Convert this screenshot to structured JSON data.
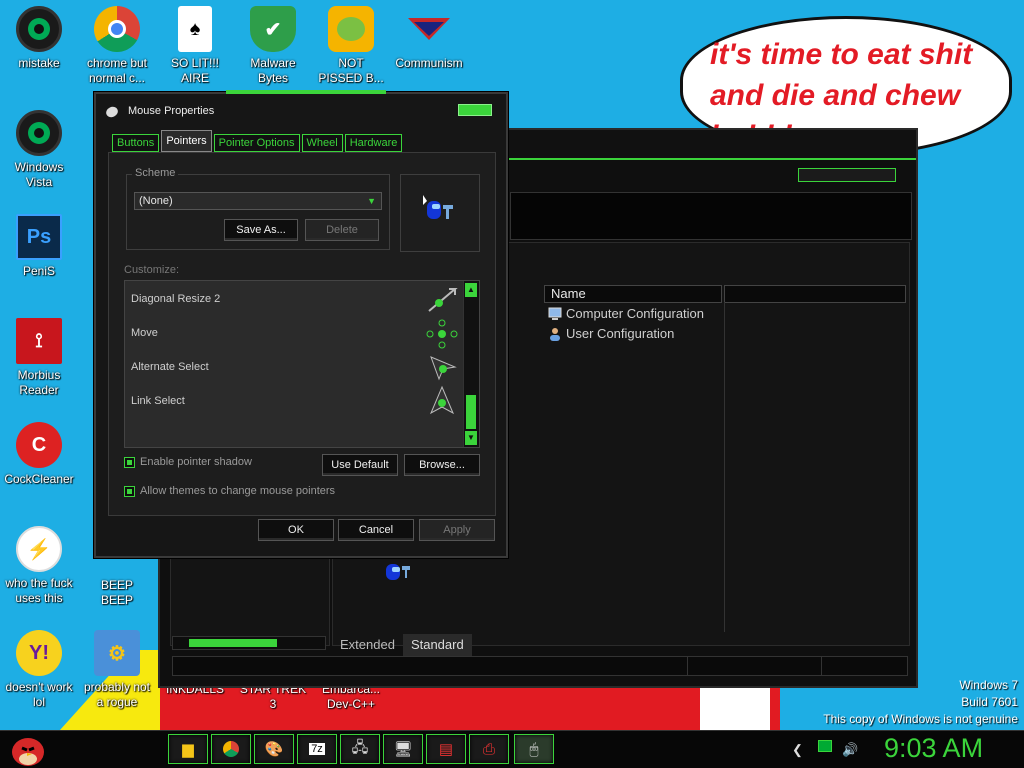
{
  "desktop": {
    "icons": [
      {
        "label": "mistake"
      },
      {
        "label": "chrome but\nnormal c..."
      },
      {
        "label": "SO LIT!!!\nAIRE"
      },
      {
        "label": "Malware\nBytes"
      },
      {
        "label": "NOT\nPISSED B..."
      },
      {
        "label": "Communism"
      },
      {
        "label": "Windows\nVista"
      },
      {
        "label": "PeniS"
      },
      {
        "label": "Morbius\nReader"
      },
      {
        "label": "CockCleaner"
      },
      {
        "label": "who the fuck\nuses this"
      },
      {
        "label": "BEEP\nBEEP"
      },
      {
        "label": "doesn't work\nlol"
      },
      {
        "label": "probably not\na rogue"
      },
      {
        "label": "INKDALLS"
      },
      {
        "label": "STAR TREK\n3"
      },
      {
        "label": "Embarca...\nDev-C++"
      }
    ],
    "bubble_text": "it's time to eat shit and die and chew bubble gum",
    "watermark": {
      "line1": "Windows 7",
      "line2": "Build 7601",
      "line3": "This copy of Windows is not genuine"
    }
  },
  "explorer": {
    "column_name": "Name",
    "items": [
      "Computer Configuration",
      "User Configuration"
    ],
    "view_tabs": [
      "Extended",
      "Standard"
    ]
  },
  "dialog": {
    "title": "Mouse Properties",
    "tabs": [
      "Buttons",
      "Pointers",
      "Pointer Options",
      "Wheel",
      "Hardware"
    ],
    "active_tab": "Pointers",
    "scheme_label": "Scheme",
    "scheme_value": "(None)",
    "save_as": "Save As...",
    "delete": "Delete",
    "customize_label": "Customize:",
    "pointers": [
      "Diagonal Resize 2",
      "Move",
      "Alternate Select",
      "Link Select"
    ],
    "enable_shadow": "Enable pointer shadow",
    "use_default": "Use Default",
    "browse": "Browse...",
    "allow_themes": "Allow themes to change mouse pointers",
    "ok": "OK",
    "cancel": "Cancel",
    "apply": "Apply"
  },
  "taskbar": {
    "clock": "9:03 AM",
    "buttons": [
      "folder",
      "chrome",
      "paint",
      "7zip",
      "network",
      "monitor",
      "fax",
      "printer",
      "mouse"
    ]
  },
  "colors": {
    "accent": "#3bd43b",
    "desktop": "#1eaee4",
    "bubble_text": "#e31b25"
  }
}
